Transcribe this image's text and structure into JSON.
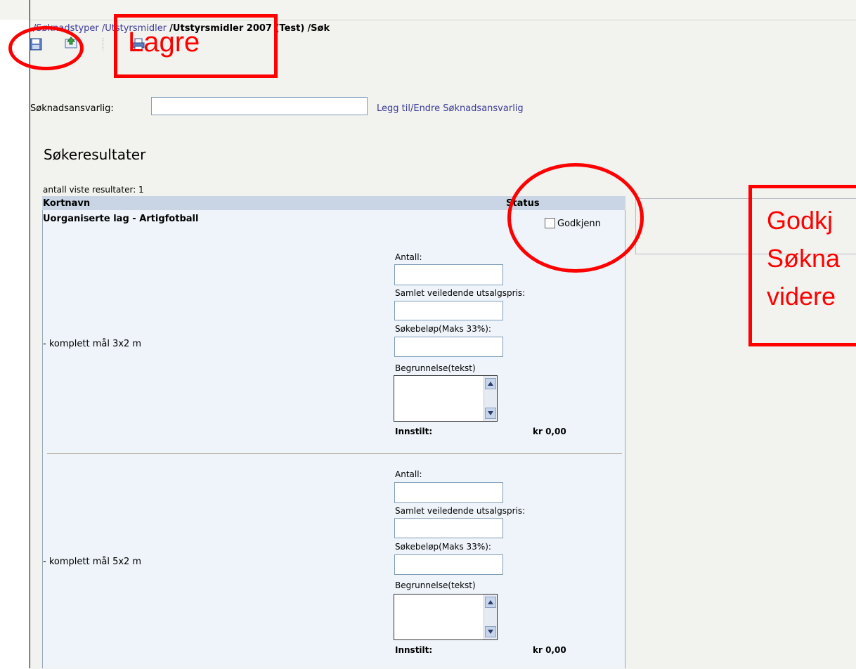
{
  "breadcrumb": {
    "part1": "/Søknadstyper",
    "part2": "/Utstyrsmidler",
    "part3": "/Utstyrsmidler 2007 (Test)",
    "part4": "/Søk"
  },
  "toolbar": {
    "icons": [
      "save-icon",
      "upload-icon",
      "print-icon"
    ]
  },
  "form": {
    "responsible_label": "Søknadsansvarlig:",
    "responsible_value": "",
    "change_link": "Legg til/Endre Søknadsansvarlig"
  },
  "results": {
    "title": "Søkeresultater",
    "count_text": "antall viste resultater: 1",
    "col_short_name": "Kortnavn",
    "col_status": "Status",
    "row_title": "Uorganiserte lag - Artigfotball",
    "approve_label": "Godkjenn",
    "approve_checked": false,
    "items": [
      {
        "label": "- komplett mål 3x2 m",
        "qty_label": "Antall:",
        "price_label": "Samlet veiledende utsalgspris:",
        "amount_label": "Søkebeløp(Maks 33%):",
        "reason_label": "Begrunnelse(tekst)",
        "recommended_label": "Innstilt:",
        "recommended_value": "kr 0,00"
      },
      {
        "label": "- komplett mål 5x2 m",
        "qty_label": "Antall:",
        "price_label": "Samlet veiledende utsalgspris:",
        "amount_label": "Søkebeløp(Maks 33%):",
        "reason_label": "Begrunnelse(tekst)",
        "recommended_label": "Innstilt:",
        "recommended_value": "kr 0,00"
      }
    ]
  },
  "annotations": {
    "lagre": "Lagre",
    "side_line1": "Godkj",
    "side_line2": "Søkna",
    "side_line3": "videre",
    "color": "#ff0000"
  }
}
